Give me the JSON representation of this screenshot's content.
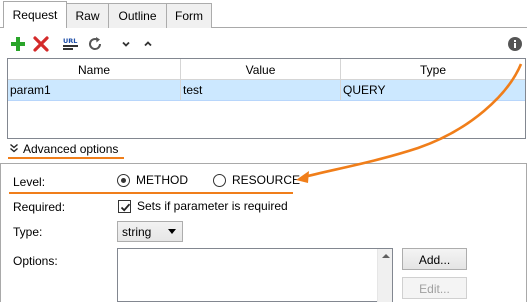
{
  "tabs": [
    {
      "label": "Request",
      "active": true
    },
    {
      "label": "Raw",
      "active": false
    },
    {
      "label": "Outline",
      "active": false
    },
    {
      "label": "Form",
      "active": false
    }
  ],
  "toolbar": {
    "icons": [
      "add-icon",
      "delete-icon",
      "url-encode-icon",
      "refresh-icon",
      "move-down-icon",
      "move-up-icon",
      "info-icon"
    ]
  },
  "params_table": {
    "headers": [
      "Name",
      "Value",
      "Type"
    ],
    "rows": [
      {
        "name": "param1",
        "value": "test",
        "type": "QUERY",
        "selected": true
      }
    ]
  },
  "advanced": {
    "label": "Advanced options"
  },
  "options": {
    "level_label": "Level:",
    "level_choices": [
      {
        "label": "METHOD",
        "selected": true
      },
      {
        "label": "RESOURCE",
        "selected": false
      }
    ],
    "required_label": "Required:",
    "required_checkbox_label": "Sets if parameter is required",
    "required_checked": true,
    "type_label": "Type:",
    "type_value": "string",
    "options_label": "Options:",
    "add_button": "Add...",
    "edit_button": "Edit..."
  },
  "colors": {
    "accent_orange": "#f07e1a",
    "selection_blue": "#cce8ff",
    "add_green": "#2aa52a",
    "delete_red": "#d42a2a"
  }
}
